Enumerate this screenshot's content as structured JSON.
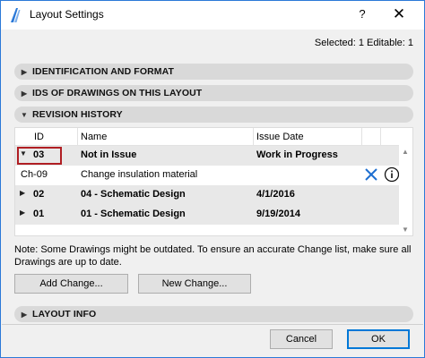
{
  "window": {
    "title": "Layout Settings",
    "help_label": "?",
    "close_label": "✕"
  },
  "selection_info": "Selected: 1 Editable: 1",
  "sections": {
    "identification": {
      "label": "IDENTIFICATION AND FORMAT",
      "expanded": false
    },
    "drawing_ids": {
      "label": "IDS OF DRAWINGS ON THIS LAYOUT",
      "expanded": false
    },
    "revision_history": {
      "label": "REVISION HISTORY",
      "expanded": true
    },
    "layout_info": {
      "label": "LAYOUT INFO",
      "expanded": false
    }
  },
  "revision_table": {
    "columns": [
      "ID",
      "Name",
      "Issue Date"
    ],
    "rows": [
      {
        "id": "03",
        "name": "Not in Issue",
        "issue_date": "Work in Progress",
        "expanded": true,
        "bold": true,
        "highlighted": true
      },
      {
        "id": "Ch-09",
        "name": "Change insulation material",
        "issue_date": "",
        "child": true,
        "bold": false
      },
      {
        "id": "02",
        "name": "04 - Schematic Design",
        "issue_date": "4/1/2016",
        "expanded": false,
        "bold": true
      },
      {
        "id": "01",
        "name": "01 - Schematic Design",
        "issue_date": "9/19/2014",
        "expanded": false,
        "bold": true
      }
    ],
    "row_icons": [
      "delete-x-icon",
      "info-icon"
    ]
  },
  "note": "Note: Some Drawings might be outdated. To ensure an accurate Change list, make sure all Drawings are up to date.",
  "buttons": {
    "add_change": "Add Change...",
    "new_change": "New Change...",
    "cancel": "Cancel",
    "ok": "OK"
  },
  "colors": {
    "accent_blue": "#2b79d8",
    "highlight_red": "#b01e23",
    "section_bar": "#d9d9d9"
  }
}
